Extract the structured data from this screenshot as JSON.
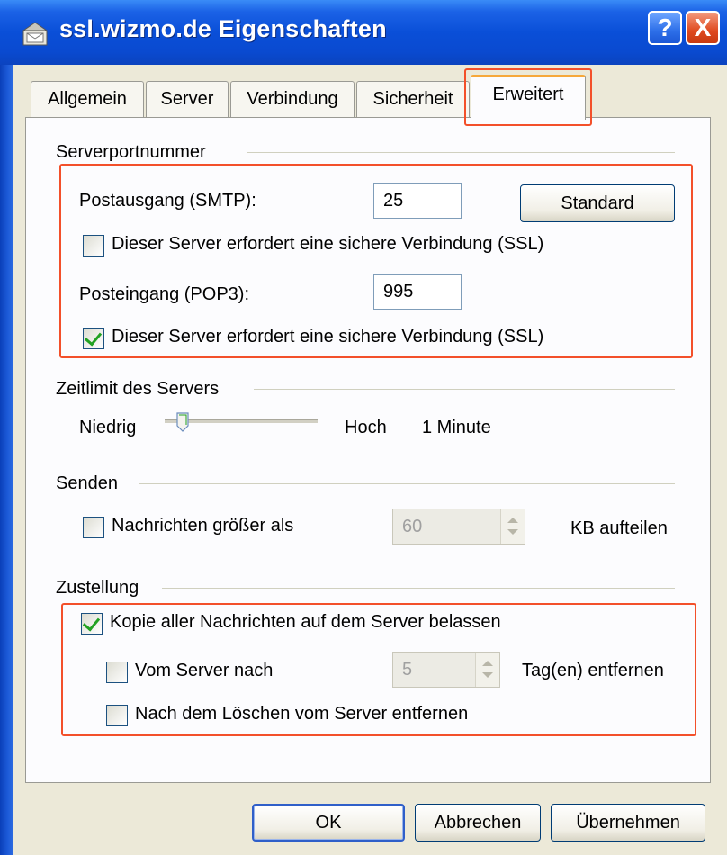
{
  "window": {
    "title": "ssl.wizmo.de Eigenschaften",
    "help_label": "?",
    "close_label": "X"
  },
  "tabs": [
    {
      "label": "Allgemein"
    },
    {
      "label": "Server"
    },
    {
      "label": "Verbindung"
    },
    {
      "label": "Sicherheit"
    },
    {
      "label": "Erweitert",
      "active": true
    }
  ],
  "server_ports": {
    "heading": "Serverportnummer",
    "smtp_label": "Postausgang (SMTP):",
    "smtp_value": "25",
    "standard_button": "Standard",
    "smtp_ssl_label": "Dieser Server erfordert eine sichere Verbindung (SSL)",
    "smtp_ssl_checked": false,
    "pop3_label": "Posteingang (POP3):",
    "pop3_value": "995",
    "pop3_ssl_label": "Dieser Server erfordert eine sichere Verbindung (SSL)",
    "pop3_ssl_checked": true
  },
  "timeout": {
    "heading": "Zeitlimit des Servers",
    "low_label": "Niedrig",
    "high_label": "Hoch",
    "value_label": "1 Minute"
  },
  "send": {
    "heading": "Senden",
    "split_label": "Nachrichten größer als",
    "split_checked": false,
    "split_value": "60",
    "split_unit": "KB aufteilen"
  },
  "delivery": {
    "heading": "Zustellung",
    "keep_copy_label": "Kopie aller Nachrichten auf dem Server belassen",
    "keep_copy_checked": true,
    "remove_after_label": "Vom Server nach",
    "remove_after_checked": false,
    "remove_after_value": "5",
    "remove_after_unit": "Tag(en) entfernen",
    "remove_on_delete_label": "Nach dem Löschen vom Server entfernen",
    "remove_on_delete_checked": false
  },
  "buttons": {
    "ok": "OK",
    "cancel": "Abbrechen",
    "apply": "Übernehmen"
  },
  "colors": {
    "highlight": "#f3502a",
    "titlebar": "#0a4fd8",
    "check": "#21a121"
  }
}
